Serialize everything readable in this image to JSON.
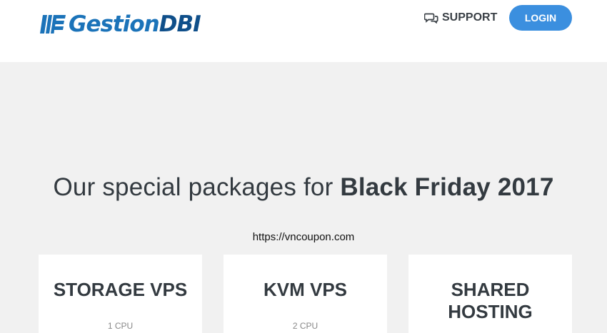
{
  "header": {
    "logo": {
      "text_part1": "Gestion",
      "text_part2": "DBI"
    },
    "support_label": "SUPPORT",
    "support_icon": "comments-icon",
    "login_label": "LOGIN"
  },
  "hero": {
    "headline_pre": "Our special packages for ",
    "headline_bold": "Black Friday 2017",
    "url": "https://vncoupon.com"
  },
  "cards": [
    {
      "title": "STORAGE VPS",
      "spec": "1 CPU"
    },
    {
      "title": "KVM VPS",
      "spec": "2 CPU"
    },
    {
      "title_line1": "SHARED",
      "title_line2": "HOSTING"
    }
  ],
  "colors": {
    "brand_blue": "#1b73b9",
    "brand_dark_blue": "#0f4f8a",
    "login_bg": "#3b8fdf",
    "page_bg": "#f1f1f1",
    "text_dark": "#333a40"
  }
}
